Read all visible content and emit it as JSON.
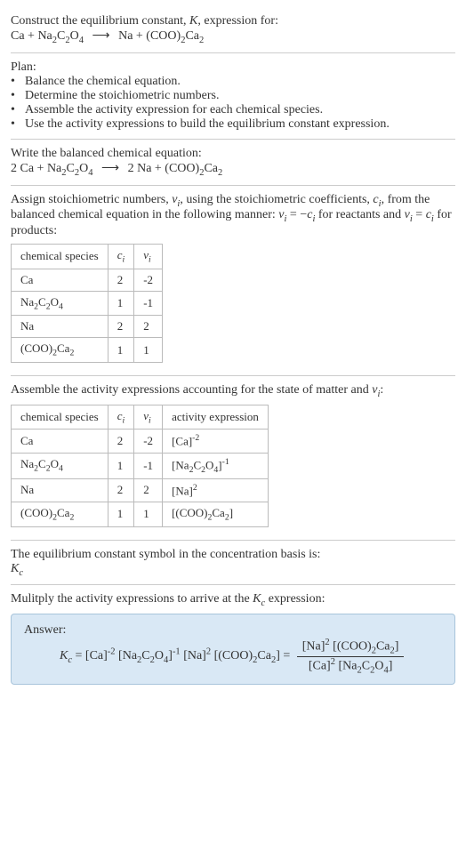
{
  "intro": {
    "line1a": "Construct the equilibrium constant, ",
    "K": "K",
    "line1b": ", expression for:"
  },
  "plan": {
    "heading": "Plan:",
    "items": [
      "Balance the chemical equation.",
      "Determine the stoichiometric numbers.",
      "Assemble the activity expression for each chemical species.",
      "Use the activity expressions to build the equilibrium constant expression."
    ]
  },
  "balanced_heading": "Write the balanced chemical equation:",
  "assign_text_a": "Assign stoichiometric numbers, ",
  "nu_i": "ν",
  "assign_text_b": ", using the stoichiometric coefficients, ",
  "c_i": "c",
  "assign_text_c": ", from the balanced chemical equation in the following manner: ",
  "assign_rule1": " = −",
  "assign_text_d": " for reactants and ",
  "assign_rule2": " = ",
  "assign_text_e": " for products:",
  "table1": {
    "headers": [
      "chemical species",
      "cᵢ",
      "νᵢ"
    ],
    "rows": [
      {
        "species": "Ca",
        "c": "2",
        "v": "-2"
      },
      {
        "species": "Na2C2O4",
        "c": "1",
        "v": "-1"
      },
      {
        "species": "Na",
        "c": "2",
        "v": "2"
      },
      {
        "species": "(COO)2Ca2",
        "c": "1",
        "v": "1"
      }
    ]
  },
  "assemble_text_a": "Assemble the activity expressions accounting for the state of matter and ",
  "assemble_text_b": ":",
  "table2": {
    "headers": [
      "chemical species",
      "cᵢ",
      "νᵢ",
      "activity expression"
    ],
    "rows": [
      {
        "species": "Ca",
        "c": "2",
        "v": "-2"
      },
      {
        "species": "Na2C2O4",
        "c": "1",
        "v": "-1"
      },
      {
        "species": "Na",
        "c": "2",
        "v": "2"
      },
      {
        "species": "(COO)2Ca2",
        "c": "1",
        "v": "1"
      }
    ]
  },
  "eq_symbol_text": "The equilibrium constant symbol in the concentration basis is:",
  "Kc": "K",
  "Kc_sub": "c",
  "multiply_text_a": "Mulitply the activity expressions to arrive at the ",
  "multiply_text_b": " expression:",
  "answer_label": "Answer:"
}
